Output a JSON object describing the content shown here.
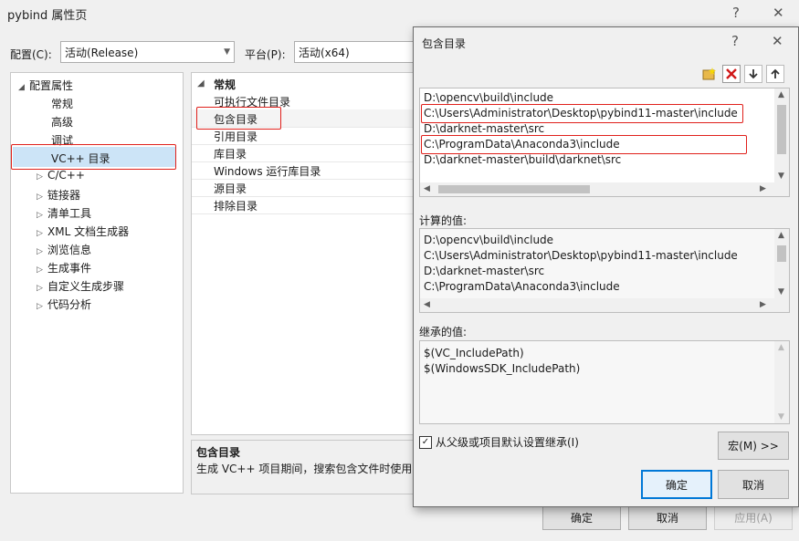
{
  "window": {
    "title": "pybind 属性页",
    "help": "?",
    "close": "✕"
  },
  "config_bar": {
    "config_label": "配置(C):",
    "config_value": "活动(Release)",
    "platform_label": "平台(P):",
    "platform_value": "活动(x64)"
  },
  "tree": {
    "root": "配置属性",
    "items": [
      "常规",
      "高级",
      "调试",
      "VC++ 目录",
      "C/C++",
      "链接器",
      "清单工具",
      "XML 文档生成器",
      "浏览信息",
      "生成事件",
      "自定义生成步骤",
      "代码分析"
    ]
  },
  "grid": {
    "section": "常规",
    "rows": [
      "可执行文件目录",
      "包含目录",
      "引用目录",
      "库目录",
      "Windows 运行库目录",
      "源目录",
      "排除目录"
    ]
  },
  "description": {
    "title": "包含目录",
    "text": "生成 VC++ 项目期间，搜索包含文件时使用的"
  },
  "main_buttons": {
    "ok": "确定",
    "cancel": "取消",
    "apply": "应用(A)"
  },
  "dialog": {
    "title": "包含目录",
    "help": "?",
    "close": "✕",
    "entries": [
      "D:\\opencv\\build\\include",
      "C:\\Users\\Administrator\\Desktop\\pybind11-master\\include",
      "D:\\darknet-master\\src",
      "C:\\ProgramData\\Anaconda3\\include",
      "D:\\darknet-master\\build\\darknet\\src"
    ],
    "computed_label": "计算的值:",
    "computed": [
      "D:\\opencv\\build\\include",
      "C:\\Users\\Administrator\\Desktop\\pybind11-master\\include",
      "D:\\darknet-master\\src",
      "C:\\ProgramData\\Anaconda3\\include"
    ],
    "inherited_label": "继承的值:",
    "inherited": [
      "$(VC_IncludePath)",
      "$(WindowsSDK_IncludePath)"
    ],
    "inherit_checkbox": "从父级或项目默认设置继承(I)",
    "macro_button": "宏(M) >>",
    "ok": "确定",
    "cancel": "取消"
  },
  "colors": {
    "highlight": "#e0201b",
    "selection": "#cce4f7",
    "default_button": "#0078d7"
  }
}
